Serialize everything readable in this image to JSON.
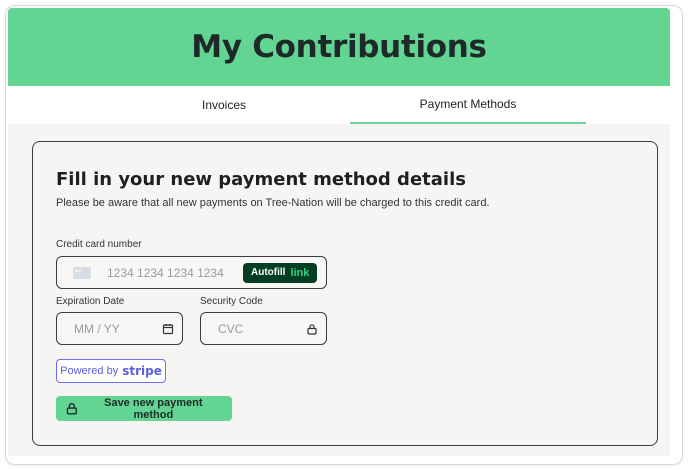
{
  "header": {
    "title": "My Contributions"
  },
  "tabs": [
    {
      "label": "Invoices",
      "active": false
    },
    {
      "label": "Payment Methods",
      "active": true
    }
  ],
  "card": {
    "title": "Fill in your new payment method details",
    "description": "Please be aware that all new payments on Tree-Nation will be charged to this credit card.",
    "credit_card": {
      "label": "Credit card number",
      "placeholder": "1234 1234 1234 1234",
      "value": "",
      "autofill_label": "Autofill",
      "link_label": "link"
    },
    "expiration": {
      "label": "Expiration Date",
      "placeholder": "MM / YY",
      "value": ""
    },
    "security": {
      "label": "Security Code",
      "placeholder": "CVC",
      "value": ""
    },
    "stripe_badge": {
      "powered_by": "Powered by",
      "brand": "stripe"
    },
    "save_button": {
      "label": "Save new payment method"
    }
  },
  "colors": {
    "brand_green": "#63d592",
    "tab_underline": "#6fd39a",
    "stripe_purple": "#5a5fe0",
    "link_dark": "#033d22",
    "link_green": "#35d07f"
  },
  "icons": [
    "card-icon",
    "calendar-icon",
    "lock-icon",
    "lock-icon"
  ]
}
